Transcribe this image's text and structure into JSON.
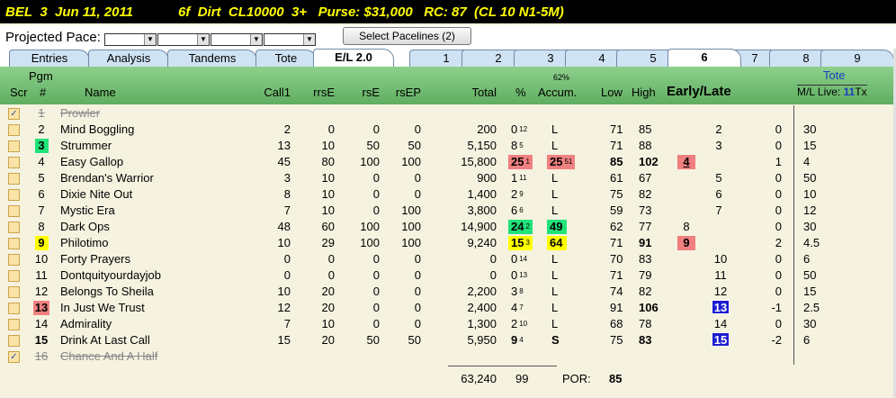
{
  "race_header": {
    "track": "BEL",
    "race": "3",
    "date": "Jun 11, 2011",
    "distance": "6f",
    "surface": "Dirt",
    "race_class": "CL10000",
    "age": "3+",
    "purse": "Purse: $31,000",
    "rc": "RC: 87",
    "condition": "(CL 10 N1-5M)"
  },
  "pace": {
    "label": "Projected Pace:",
    "select_button": "Select Pacelines  (2)"
  },
  "tabs": {
    "left": [
      "Entries",
      "Analysis",
      "Tandems",
      "Tote",
      "E/L 2.0"
    ],
    "active": "E/L 2.0",
    "races": [
      "1",
      "2",
      "3",
      "4",
      "5",
      "6",
      "7",
      "8",
      "9"
    ],
    "active_race": "6"
  },
  "columns": {
    "pgm_top": "Pgm",
    "scr": "Scr",
    "pgm": "#",
    "name": "Name",
    "call1": "Call1",
    "rrse": "rrsE",
    "rse": "rsE",
    "rsep": "rsEP",
    "total": "Total",
    "pct": "%",
    "accum_pct": "62%",
    "accum": "Accum.",
    "low": "Low",
    "high": "High",
    "early_late": "Early/Late",
    "tote": "Tote",
    "ml_live": "M/L Live:",
    "live_count": "11",
    "tx": "Tx"
  },
  "colors": {
    "green": "#22e27a",
    "yellow": "#ffff00",
    "red": "#f08080",
    "blue": "#1c1cd0"
  },
  "entries": [
    {
      "scr": true,
      "pgm": "1",
      "name": "Prowler",
      "scratched": true,
      "call1": "",
      "rrse": "",
      "rse": "",
      "rsep": "",
      "total": "",
      "pct": "",
      "pct_rank": "",
      "accum": "",
      "accum_rank": "",
      "low": "",
      "high": "",
      "e1": "",
      "e2": "",
      "e3": "",
      "e4": "",
      "ml": ""
    },
    {
      "scr": false,
      "pgm": "2",
      "name": "Mind Boggling",
      "call1": "2",
      "rrse": "0",
      "rse": "0",
      "rsep": "0",
      "total": "200",
      "pct": "0",
      "pct_rank": "12",
      "accum": "L",
      "accum_rank": "",
      "low": "71",
      "high": "85",
      "e1": "",
      "e2": "2",
      "e3": "",
      "e4": "0",
      "ml": "30"
    },
    {
      "scr": false,
      "pgm": "3",
      "pgm_color": "green",
      "name": "Strummer",
      "call1": "13",
      "rrse": "10",
      "rse": "50",
      "rsep": "50",
      "total": "5,150",
      "pct": "8",
      "pct_rank": "5",
      "accum": "L",
      "accum_rank": "",
      "low": "71",
      "high": "88",
      "e1": "",
      "e2": "3",
      "e3": "",
      "e4": "0",
      "ml": "15"
    },
    {
      "scr": false,
      "pgm": "4",
      "name": "Easy Gallop",
      "call1": "45",
      "rrse": "80",
      "rse": "100",
      "rsep": "100",
      "total": "15,800",
      "pct": "25",
      "pct_rank": "1",
      "pct_color": "red",
      "accum": "25",
      "accum_rank": "51",
      "accum_color": "red",
      "low": "85",
      "high": "102",
      "high_bold": true,
      "low_bold": true,
      "e1": "4",
      "e1_color": "red",
      "e2": "",
      "e3": "",
      "e4": "1",
      "ml": "4"
    },
    {
      "scr": false,
      "pgm": "5",
      "name": "Brendan's Warrior",
      "call1": "3",
      "rrse": "10",
      "rse": "0",
      "rsep": "0",
      "total": "900",
      "pct": "1",
      "pct_rank": "11",
      "accum": "L",
      "accum_rank": "",
      "low": "61",
      "high": "67",
      "e1": "",
      "e2": "5",
      "e3": "",
      "e4": "0",
      "ml": "50"
    },
    {
      "scr": false,
      "pgm": "6",
      "name": "Dixie Nite Out",
      "call1": "8",
      "rrse": "10",
      "rse": "0",
      "rsep": "0",
      "total": "1,400",
      "pct": "2",
      "pct_rank": "9",
      "accum": "L",
      "accum_rank": "",
      "low": "75",
      "high": "82",
      "e1": "",
      "e2": "6",
      "e3": "",
      "e4": "0",
      "ml": "10"
    },
    {
      "scr": false,
      "pgm": "7",
      "name": "Mystic Era",
      "call1": "7",
      "rrse": "10",
      "rse": "0",
      "rsep": "100",
      "total": "3,800",
      "pct": "6",
      "pct_rank": "6",
      "accum": "L",
      "accum_rank": "",
      "low": "59",
      "high": "73",
      "e1": "",
      "e2": "7",
      "e3": "",
      "e4": "0",
      "ml": "12"
    },
    {
      "scr": false,
      "pgm": "8",
      "name": "Dark Ops",
      "call1": "48",
      "rrse": "60",
      "rse": "100",
      "rsep": "100",
      "total": "14,900",
      "pct": "24",
      "pct_rank": "2",
      "pct_color": "green",
      "accum": "49",
      "accum_rank": "",
      "accum_color": "green",
      "low": "62",
      "high": "77",
      "e1": "8",
      "e2": "",
      "e3": "",
      "e4": "0",
      "ml": "30"
    },
    {
      "scr": false,
      "pgm": "9",
      "pgm_color": "yellow",
      "name": "Philotimo",
      "call1": "10",
      "rrse": "29",
      "rse": "100",
      "rsep": "100",
      "total": "9,240",
      "pct": "15",
      "pct_rank": "3",
      "pct_color": "yellow",
      "accum": "64",
      "accum_rank": "",
      "accum_color": "yellow",
      "low": "71",
      "high": "91",
      "high_bold": true,
      "e1": "9",
      "e1_color": "red",
      "e2": "",
      "e3": "",
      "e4": "2",
      "ml": "4.5"
    },
    {
      "scr": false,
      "pgm": "10",
      "name": "Forty Prayers",
      "call1": "0",
      "rrse": "0",
      "rse": "0",
      "rsep": "0",
      "total": "0",
      "pct": "0",
      "pct_rank": "14",
      "accum": "L",
      "accum_rank": "",
      "low": "70",
      "high": "83",
      "e1": "",
      "e2": "",
      "e3": "10",
      "e4": "0",
      "ml": "6"
    },
    {
      "scr": false,
      "pgm": "11",
      "name": "Dontquityourdayjob",
      "call1": "0",
      "rrse": "0",
      "rse": "0",
      "rsep": "0",
      "total": "0",
      "pct": "0",
      "pct_rank": "13",
      "accum": "L",
      "accum_rank": "",
      "low": "71",
      "high": "79",
      "e1": "",
      "e2": "",
      "e3": "11",
      "e4": "0",
      "ml": "50"
    },
    {
      "scr": false,
      "pgm": "12",
      "name": "Belongs To Sheila",
      "call1": "10",
      "rrse": "20",
      "rse": "0",
      "rsep": "0",
      "total": "2,200",
      "pct": "3",
      "pct_rank": "8",
      "accum": "L",
      "accum_rank": "",
      "low": "74",
      "high": "82",
      "e1": "",
      "e2": "",
      "e3": "12",
      "e4": "0",
      "ml": "15"
    },
    {
      "scr": false,
      "pgm": "13",
      "pgm_color": "red",
      "name": "In Just We Trust",
      "call1": "12",
      "rrse": "20",
      "rse": "0",
      "rsep": "0",
      "total": "2,400",
      "pct": "4",
      "pct_rank": "7",
      "accum": "L",
      "accum_rank": "",
      "low": "91",
      "high": "106",
      "high_bold": true,
      "e1": "",
      "e2": "",
      "e3": "13",
      "e3_color": "blue",
      "e4": "-1",
      "ml": "2.5"
    },
    {
      "scr": false,
      "pgm": "14",
      "name": "Admirality",
      "call1": "7",
      "rrse": "10",
      "rse": "0",
      "rsep": "0",
      "total": "1,300",
      "pct": "2",
      "pct_rank": "10",
      "accum": "L",
      "accum_rank": "",
      "low": "68",
      "high": "78",
      "e1": "",
      "e2": "",
      "e3": "14",
      "e4": "0",
      "ml": "30"
    },
    {
      "scr": false,
      "pgm": "15",
      "pgm_bold": true,
      "name": "Drink At Last Call",
      "call1": "15",
      "rrse": "20",
      "rse": "50",
      "rsep": "50",
      "total": "5,950",
      "pct": "9",
      "pct_rank": "4",
      "pct_bold": true,
      "accum": "S",
      "accum_rank": "",
      "accum_bold": true,
      "low": "75",
      "high": "83",
      "high_bold": true,
      "e1": "",
      "e2": "",
      "e3": "15",
      "e3_color": "blue",
      "e4": "-2",
      "ml": "6"
    },
    {
      "scr": true,
      "pgm": "16",
      "name": "Chance And A Half",
      "scratched": true,
      "call1": "",
      "rrse": "",
      "rse": "",
      "rsep": "",
      "total": "",
      "pct": "",
      "pct_rank": "",
      "accum": "",
      "accum_rank": "",
      "low": "",
      "high": "",
      "e1": "",
      "e2": "",
      "e3": "",
      "e4": "",
      "ml": ""
    }
  ],
  "totals": {
    "total": "63,240",
    "pct": "99",
    "por_label": "POR:",
    "por": "85"
  }
}
